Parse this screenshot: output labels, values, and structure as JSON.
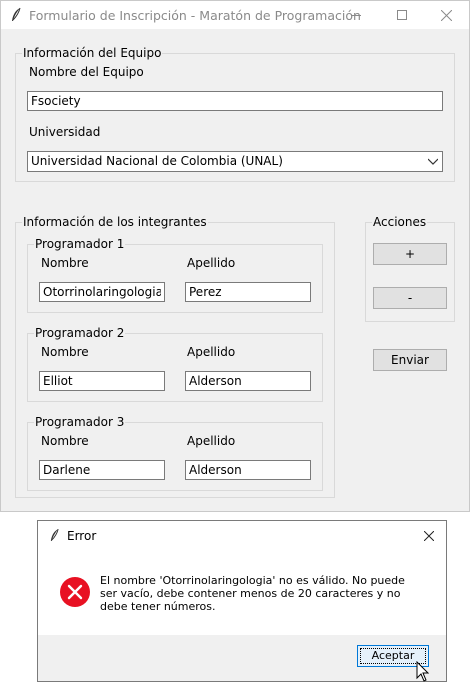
{
  "window": {
    "title": "Formulario de Inscripción - Maratón de Programación"
  },
  "team": {
    "section_title": "Información del Equipo",
    "name_label": "Nombre del Equipo",
    "name_value": "Fsociety",
    "university_label": "Universidad",
    "university_value": "Universidad Nacional de Colombia (UNAL)"
  },
  "members": {
    "section_title": "Información de los integrantes",
    "first_name_label": "Nombre",
    "last_name_label": "Apellido",
    "programmers": [
      {
        "title": "Programador 1",
        "first_name": "Otorrinolaringologia",
        "last_name": "Perez"
      },
      {
        "title": "Programador 2",
        "first_name": "Elliot",
        "last_name": "Alderson"
      },
      {
        "title": "Programador 3",
        "first_name": "Darlene",
        "last_name": "Alderson"
      }
    ]
  },
  "actions": {
    "section_title": "Acciones",
    "add_label": "+",
    "remove_label": "-",
    "submit_label": "Enviar"
  },
  "error_dialog": {
    "title": "Error",
    "message": "El nombre 'Otorrinolaringologia' no es válido. No puede ser vacío, debe contener menos de 20 caracteres y no debe tener números.",
    "ok_label": "Aceptar",
    "icon": "error-icon",
    "icon_color": "#e81123"
  }
}
